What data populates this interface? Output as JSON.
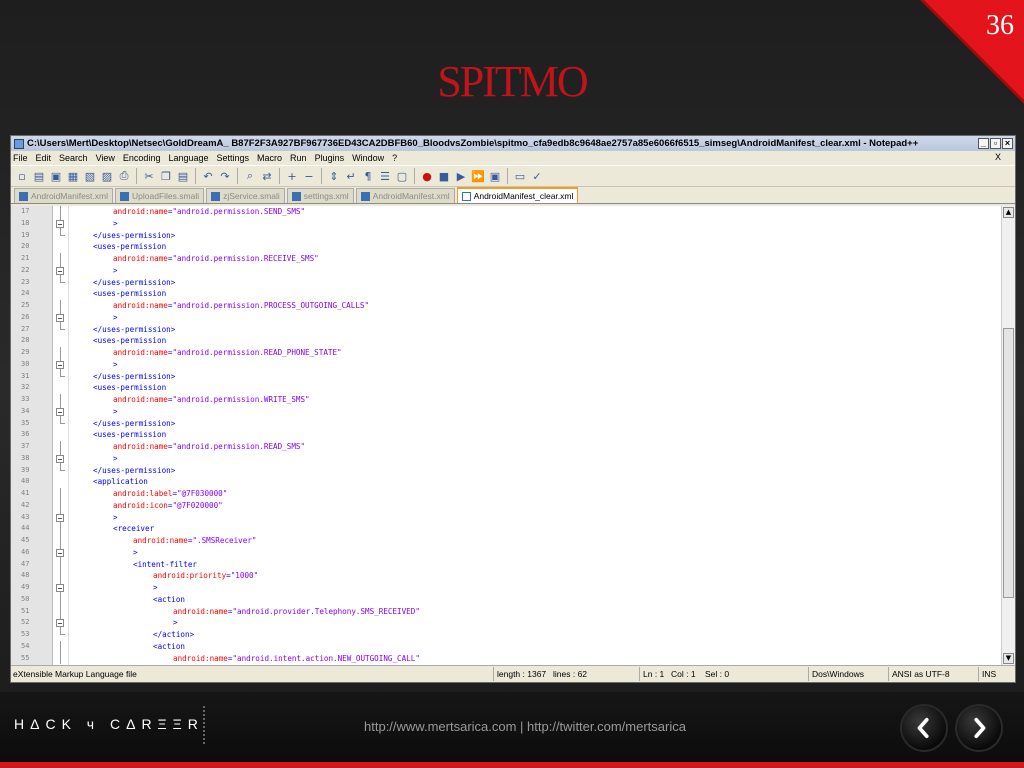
{
  "slide": {
    "number": "36",
    "title": "SPITMO",
    "footer_logo": "HΔCK ч CΔRΞΞR",
    "footer_url": "http://www.mertsarica.com | http://twitter.com/mertsarica"
  },
  "window": {
    "title": "C:\\Users\\Mert\\Desktop\\Netsec\\GoldDreamA_ B87F2F3A927BF967736ED43CA2DBFB60_BloodvsZombie\\spitmo_cfa9edb8c9648ae2757a85e6066f6515_simseg\\AndroidManifest_clear.xml - Notepad++",
    "menu": [
      "File",
      "Edit",
      "Search",
      "View",
      "Encoding",
      "Language",
      "Settings",
      "Macro",
      "Run",
      "Plugins",
      "Window",
      "?"
    ],
    "menu_close": "X",
    "tabs": [
      {
        "label": "AndroidManifest.xml",
        "active": false
      },
      {
        "label": "UploadFiles.smali",
        "active": false
      },
      {
        "label": "zjService.smali",
        "active": false
      },
      {
        "label": "settings.xml",
        "active": false
      },
      {
        "label": "AndroidManifest.xml",
        "active": false
      },
      {
        "label": "AndroidManifest_clear.xml",
        "active": true
      }
    ],
    "status": {
      "filetype": "eXtensible Markup Language file",
      "length": "length : 1367",
      "lines": "lines : 62",
      "ln": "Ln : 1",
      "col": "Col : 1",
      "sel": "Sel : 0",
      "eol": "Dos\\Windows",
      "encoding": "ANSI as UTF-8",
      "mode": "INS"
    }
  },
  "code_lines": [
    {
      "n": "17",
      "fold": "line",
      "indent": 4,
      "parts": [
        [
          "a",
          "android:name"
        ],
        [
          "t",
          "="
        ],
        [
          "v",
          "\"android.permission.SEND_SMS\""
        ]
      ]
    },
    {
      "n": "18",
      "fold": "box",
      "indent": 4,
      "parts": [
        [
          "t",
          ">"
        ]
      ]
    },
    {
      "n": "19",
      "fold": "end",
      "indent": 2,
      "parts": [
        [
          "t",
          "</uses-permission>"
        ]
      ]
    },
    {
      "n": "20",
      "fold": "none",
      "indent": 2,
      "parts": [
        [
          "t",
          "<uses-permission"
        ]
      ]
    },
    {
      "n": "21",
      "fold": "line",
      "indent": 4,
      "parts": [
        [
          "a",
          "android:name"
        ],
        [
          "t",
          "="
        ],
        [
          "v",
          "\"android.permission.RECEIVE_SMS\""
        ]
      ]
    },
    {
      "n": "22",
      "fold": "box",
      "indent": 4,
      "parts": [
        [
          "t",
          ">"
        ]
      ]
    },
    {
      "n": "23",
      "fold": "end",
      "indent": 2,
      "parts": [
        [
          "t",
          "</uses-permission>"
        ]
      ]
    },
    {
      "n": "24",
      "fold": "none",
      "indent": 2,
      "parts": [
        [
          "t",
          "<uses-permission"
        ]
      ]
    },
    {
      "n": "25",
      "fold": "line",
      "indent": 4,
      "parts": [
        [
          "a",
          "android:name"
        ],
        [
          "t",
          "="
        ],
        [
          "v",
          "\"android.permission.PROCESS_OUTGOING_CALLS\""
        ]
      ]
    },
    {
      "n": "26",
      "fold": "box",
      "indent": 4,
      "parts": [
        [
          "t",
          ">"
        ]
      ]
    },
    {
      "n": "27",
      "fold": "end",
      "indent": 2,
      "parts": [
        [
          "t",
          "</uses-permission>"
        ]
      ]
    },
    {
      "n": "28",
      "fold": "none",
      "indent": 2,
      "parts": [
        [
          "t",
          "<uses-permission"
        ]
      ]
    },
    {
      "n": "29",
      "fold": "line",
      "indent": 4,
      "parts": [
        [
          "a",
          "android:name"
        ],
        [
          "t",
          "="
        ],
        [
          "v",
          "\"android.permission.READ_PHONE_STATE\""
        ]
      ]
    },
    {
      "n": "30",
      "fold": "box",
      "indent": 4,
      "parts": [
        [
          "t",
          ">"
        ]
      ]
    },
    {
      "n": "31",
      "fold": "end",
      "indent": 2,
      "parts": [
        [
          "t",
          "</uses-permission>"
        ]
      ]
    },
    {
      "n": "32",
      "fold": "none",
      "indent": 2,
      "parts": [
        [
          "t",
          "<uses-permission"
        ]
      ]
    },
    {
      "n": "33",
      "fold": "line",
      "indent": 4,
      "parts": [
        [
          "a",
          "android:name"
        ],
        [
          "t",
          "="
        ],
        [
          "v",
          "\"android.permission.WRITE_SMS\""
        ]
      ]
    },
    {
      "n": "34",
      "fold": "box",
      "indent": 4,
      "parts": [
        [
          "t",
          ">"
        ]
      ]
    },
    {
      "n": "35",
      "fold": "end",
      "indent": 2,
      "parts": [
        [
          "t",
          "</uses-permission>"
        ]
      ]
    },
    {
      "n": "36",
      "fold": "none",
      "indent": 2,
      "parts": [
        [
          "t",
          "<uses-permission"
        ]
      ]
    },
    {
      "n": "37",
      "fold": "line",
      "indent": 4,
      "parts": [
        [
          "a",
          "android:name"
        ],
        [
          "t",
          "="
        ],
        [
          "v",
          "\"android.permission.READ_SMS\""
        ]
      ]
    },
    {
      "n": "38",
      "fold": "box",
      "indent": 4,
      "parts": [
        [
          "t",
          ">"
        ]
      ]
    },
    {
      "n": "39",
      "fold": "end",
      "indent": 2,
      "parts": [
        [
          "t",
          "</uses-permission>"
        ]
      ]
    },
    {
      "n": "40",
      "fold": "none",
      "indent": 2,
      "parts": [
        [
          "t",
          "<application"
        ]
      ]
    },
    {
      "n": "41",
      "fold": "line",
      "indent": 4,
      "parts": [
        [
          "a",
          "android:label"
        ],
        [
          "t",
          "="
        ],
        [
          "v",
          "\"@7F030000\""
        ]
      ]
    },
    {
      "n": "42",
      "fold": "line",
      "indent": 4,
      "parts": [
        [
          "a",
          "android:icon"
        ],
        [
          "t",
          "="
        ],
        [
          "v",
          "\"@7F020000\""
        ]
      ]
    },
    {
      "n": "43",
      "fold": "box",
      "indent": 4,
      "parts": [
        [
          "t",
          ">"
        ]
      ]
    },
    {
      "n": "44",
      "fold": "line",
      "indent": 4,
      "parts": [
        [
          "t",
          "<receiver"
        ]
      ]
    },
    {
      "n": "45",
      "fold": "line",
      "indent": 6,
      "parts": [
        [
          "a",
          "android:name"
        ],
        [
          "t",
          "="
        ],
        [
          "v",
          "\".SMSReceiver\""
        ]
      ]
    },
    {
      "n": "46",
      "fold": "box",
      "indent": 6,
      "parts": [
        [
          "t",
          ">"
        ]
      ]
    },
    {
      "n": "47",
      "fold": "line",
      "indent": 6,
      "parts": [
        [
          "t",
          "<intent-filter"
        ]
      ]
    },
    {
      "n": "48",
      "fold": "line",
      "indent": 8,
      "parts": [
        [
          "a",
          "android:priority"
        ],
        [
          "t",
          "="
        ],
        [
          "v",
          "\"1000\""
        ]
      ]
    },
    {
      "n": "49",
      "fold": "box",
      "indent": 8,
      "parts": [
        [
          "t",
          ">"
        ]
      ]
    },
    {
      "n": "50",
      "fold": "line",
      "indent": 8,
      "parts": [
        [
          "t",
          "<action"
        ]
      ]
    },
    {
      "n": "51",
      "fold": "line",
      "indent": 10,
      "parts": [
        [
          "a",
          "android:name"
        ],
        [
          "t",
          "="
        ],
        [
          "v",
          "\"android.provider.Telephony.SMS_RECEIVED\""
        ]
      ]
    },
    {
      "n": "52",
      "fold": "box",
      "indent": 10,
      "parts": [
        [
          "t",
          ">"
        ]
      ]
    },
    {
      "n": "53",
      "fold": "end",
      "indent": 8,
      "parts": [
        [
          "t",
          "</action>"
        ]
      ]
    },
    {
      "n": "54",
      "fold": "line",
      "indent": 8,
      "parts": [
        [
          "t",
          "<action"
        ]
      ]
    },
    {
      "n": "55",
      "fold": "line",
      "indent": 10,
      "parts": [
        [
          "a",
          "android:name"
        ],
        [
          "t",
          "="
        ],
        [
          "v",
          "\"android.intent.action.NEW_OUTGOING_CALL\""
        ]
      ]
    }
  ]
}
